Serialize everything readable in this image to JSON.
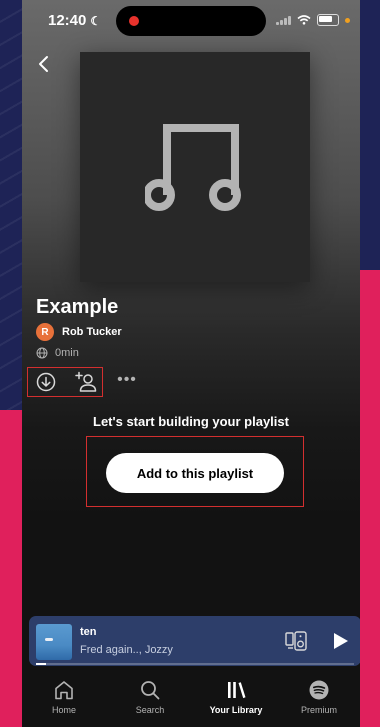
{
  "status_bar": {
    "time": "12:40"
  },
  "playlist": {
    "title": "Example",
    "owner_initial": "R",
    "owner_name": "Rob Tucker",
    "duration": "0min"
  },
  "empty_state": {
    "prompt": "Let's start building your playlist",
    "cta_label": "Add to this playlist"
  },
  "now_playing": {
    "title": "ten",
    "artist": "Fred again.., Jozzy",
    "progress": 0.03
  },
  "tabs": [
    {
      "label": "Home",
      "icon": "home-icon",
      "active": false
    },
    {
      "label": "Search",
      "icon": "search-icon",
      "active": false
    },
    {
      "label": "Your Library",
      "icon": "library-icon",
      "active": true
    },
    {
      "label": "Premium",
      "icon": "spotify-logo-icon",
      "active": false
    }
  ],
  "colors": {
    "accent": "#1db954",
    "avatar": "#e8713a",
    "miniplayer": "#2d3e6a",
    "highlight_box": "#d32f2f"
  }
}
